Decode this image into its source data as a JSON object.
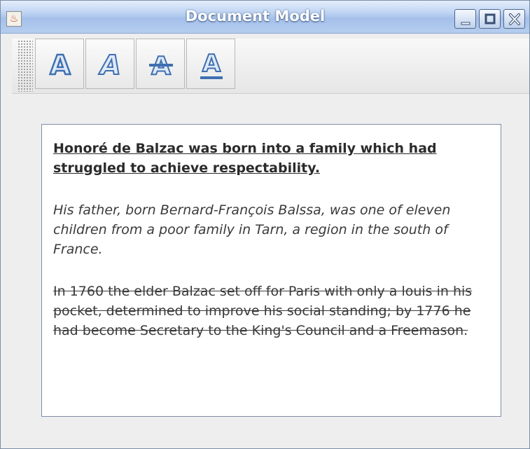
{
  "window": {
    "title": "Document Model",
    "app_icon": "java-cup-icon"
  },
  "titlebar_buttons": [
    "minimize-icon",
    "maximize-icon",
    "close-icon"
  ],
  "toolbar": {
    "buttons": [
      {
        "icon": "bold-a-icon",
        "glyph": "A"
      },
      {
        "icon": "italic-a-icon",
        "glyph": "A"
      },
      {
        "icon": "strikethrough-a-icon",
        "glyph": "A"
      },
      {
        "icon": "underline-a-icon",
        "glyph": "A"
      }
    ],
    "icon_color": "#3f6fb0"
  },
  "document": {
    "paragraphs": [
      {
        "style": "bold-underline",
        "text": "Honoré de Balzac was born into a family which had struggled to achieve respectability."
      },
      {
        "style": "italic",
        "text": "His father, born Bernard-François Balssa, was one of eleven children from a poor family in Tarn, a region in the south of France."
      },
      {
        "style": "strikethrough",
        "text": "In 1760 the elder Balzac set off for Paris with only a louis in his pocket, determined to improve his social standing; by 1776 he had become Secretary to the King's Council and a Freemason. "
      }
    ]
  }
}
